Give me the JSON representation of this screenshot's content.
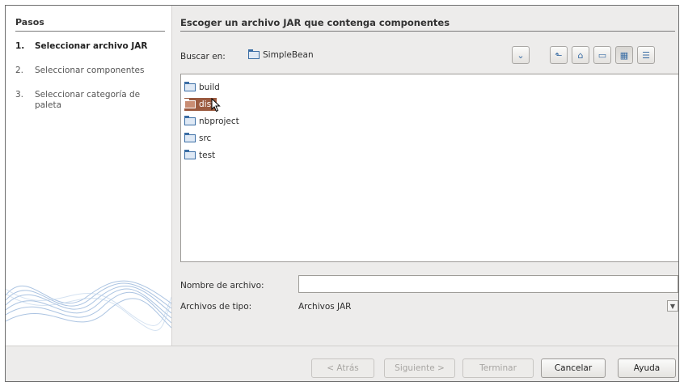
{
  "steps": {
    "title": "Pasos",
    "items": [
      {
        "num": "1.",
        "label": "Seleccionar archivo JAR"
      },
      {
        "num": "2.",
        "label": "Seleccionar componentes"
      },
      {
        "num": "3.",
        "label": "Seleccionar categoría de paleta"
      }
    ],
    "current_index": 0
  },
  "panel": {
    "title": "Escoger un archivo JAR que contenga componentes",
    "look_in_label": "Buscar en:",
    "look_in_value": "SimpleBean",
    "toolbar": [
      "up-folder-icon",
      "home-icon",
      "new-folder-icon",
      "list-view-icon",
      "details-view-icon"
    ]
  },
  "files": [
    {
      "name": "build",
      "selected": false
    },
    {
      "name": "dist",
      "selected": true
    },
    {
      "name": "nbproject",
      "selected": false
    },
    {
      "name": "src",
      "selected": false
    },
    {
      "name": "test",
      "selected": false
    }
  ],
  "file_name": {
    "label": "Nombre de archivo:",
    "value": ""
  },
  "file_type": {
    "label": "Archivos de tipo:",
    "value": "Archivos JAR"
  },
  "buttons": {
    "back": "< Atrás",
    "next": "Siguiente >",
    "finish": "Terminar",
    "cancel": "Cancelar",
    "help": "Ayuda"
  },
  "colors": {
    "selection": "#9b5a3f",
    "accent": "#3b6ea5"
  }
}
